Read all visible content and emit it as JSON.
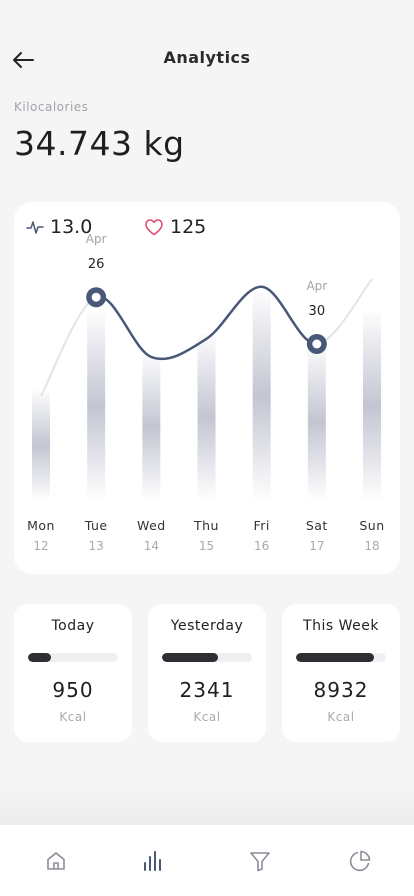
{
  "header": {
    "title": "Analytics"
  },
  "summary": {
    "label": "Kilocalories",
    "value": "34.743 kg"
  },
  "stats": {
    "activity": "13.0",
    "heart": "125"
  },
  "colors": {
    "accent": "#4a5877",
    "heart": "#e04a6e",
    "bar": "#c3c6d2"
  },
  "chart_data": {
    "type": "line",
    "categories": [
      "Mon",
      "Tue",
      "Wed",
      "Thu",
      "Fri",
      "Sat",
      "Sun"
    ],
    "dates": [
      "12",
      "13",
      "14",
      "15",
      "16",
      "17",
      "18"
    ],
    "series": [
      {
        "values": [
          40,
          78,
          55,
          62,
          82,
          60,
          85
        ]
      }
    ],
    "bars": [
      42,
      72,
      56,
      64,
      80,
      60,
      72
    ],
    "highlights": [
      {
        "index": 1,
        "month": "Apr",
        "day": "26"
      },
      {
        "index": 5,
        "month": "Apr",
        "day": "30"
      }
    ],
    "ylim": [
      0,
      100
    ]
  },
  "cards": [
    {
      "label": "Today",
      "value": "950",
      "unit": "Kcal",
      "progress": 0.25
    },
    {
      "label": "Yesterday",
      "value": "2341",
      "unit": "Kcal",
      "progress": 0.62
    },
    {
      "label": "This Week",
      "value": "8932",
      "unit": "Kcal",
      "progress": 0.87
    }
  ],
  "nav": {
    "items": [
      "home-icon",
      "chart-icon",
      "filter-icon",
      "pie-icon"
    ],
    "active": "chart-icon"
  }
}
